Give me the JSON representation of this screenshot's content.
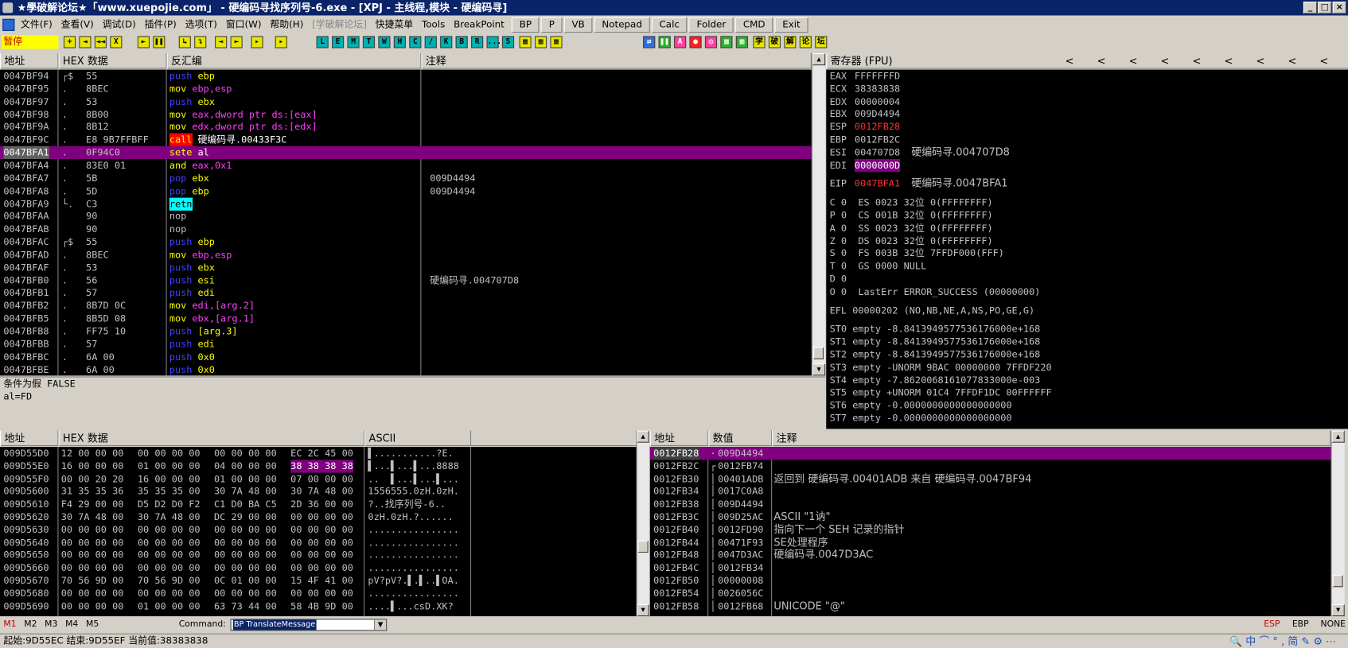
{
  "app": {
    "title": "★學破解论坛★「www.xuepojie.com」 - 硬编码寻找序列号-6.exe - [XPJ - 主线程,模块 - 硬编码寻]"
  },
  "menu": [
    {
      "label": "文件(F)"
    },
    {
      "label": "查看(V)"
    },
    {
      "label": "调试(D)"
    },
    {
      "label": "插件(P)"
    },
    {
      "label": "选项(T)"
    },
    {
      "label": "窗口(W)"
    },
    {
      "label": "帮助(H)"
    },
    {
      "label": "[学破解论坛]",
      "disabled": true
    },
    {
      "label": "快捷菜单"
    },
    {
      "label": "Tools"
    },
    {
      "label": "BreakPoint"
    }
  ],
  "menu_tools": [
    "BP",
    "P",
    "VB",
    "Notepad",
    "Calc",
    "Folder",
    "CMD",
    "Exit"
  ],
  "toolbar": {
    "status": "暂停",
    "letters": [
      "L",
      "E",
      "M",
      "T",
      "W",
      "H",
      "C",
      "/",
      "K",
      "B",
      "R",
      "...",
      "S"
    ],
    "right_chars": [
      "学",
      "破",
      "解",
      "论",
      "坛"
    ]
  },
  "cpu": {
    "headers": {
      "addr": "地址",
      "hex": "HEX 数据",
      "disasm": "反汇编",
      "comment": "注释"
    },
    "rows": [
      {
        "addr": "0047BF94",
        "mark": "┌$",
        "hex": "55",
        "mn": "push",
        "op": "ebp",
        "cmt": ""
      },
      {
        "addr": "0047BF95",
        "mark": ".",
        "hex": "8BEC",
        "mn": "mov",
        "op": "ebp,esp",
        "cmt": ""
      },
      {
        "addr": "0047BF97",
        "mark": ".",
        "hex": "53",
        "mn": "push",
        "op": "ebx",
        "cmt": ""
      },
      {
        "addr": "0047BF98",
        "mark": ".",
        "hex": "8B00",
        "mn": "mov",
        "op": "eax,dword ptr ds:[eax]",
        "cmt": ""
      },
      {
        "addr": "0047BF9A",
        "mark": ".",
        "hex": "8B12",
        "mn": "mov",
        "op": "edx,dword ptr ds:[edx]",
        "cmt": ""
      },
      {
        "addr": "0047BF9C",
        "mark": ".",
        "hex": "E8 9B7FFBFF",
        "mn": "call",
        "op": "硬编码寻.00433F3C",
        "cmt": ""
      },
      {
        "addr": "0047BFA1",
        "mark": ".",
        "hex": "0F94C0",
        "mn": "sete",
        "op": "al",
        "cmt": "",
        "sel": true
      },
      {
        "addr": "0047BFA4",
        "mark": ".",
        "hex": "83E0 01",
        "mn": "and",
        "op": "eax,0x1",
        "cmt": ""
      },
      {
        "addr": "0047BFA7",
        "mark": ".",
        "hex": "5B",
        "mn": "pop",
        "op": "ebx",
        "cmt": "009D4494"
      },
      {
        "addr": "0047BFA8",
        "mark": ".",
        "hex": "5D",
        "mn": "pop",
        "op": "ebp",
        "cmt": "009D4494"
      },
      {
        "addr": "0047BFA9",
        "mark": "└.",
        "hex": "C3",
        "mn": "retn",
        "op": "",
        "cmt": ""
      },
      {
        "addr": "0047BFAA",
        "mark": "",
        "hex": "90",
        "mn": "nop",
        "op": "",
        "cmt": ""
      },
      {
        "addr": "0047BFAB",
        "mark": "",
        "hex": "90",
        "mn": "nop",
        "op": "",
        "cmt": ""
      },
      {
        "addr": "0047BFAC",
        "mark": "┌$",
        "hex": "55",
        "mn": "push",
        "op": "ebp",
        "cmt": ""
      },
      {
        "addr": "0047BFAD",
        "mark": ".",
        "hex": "8BEC",
        "mn": "mov",
        "op": "ebp,esp",
        "cmt": ""
      },
      {
        "addr": "0047BFAF",
        "mark": ".",
        "hex": "53",
        "mn": "push",
        "op": "ebx",
        "cmt": ""
      },
      {
        "addr": "0047BFB0",
        "mark": ".",
        "hex": "56",
        "mn": "push",
        "op": "esi",
        "cmt": "硬编码寻.004707D8"
      },
      {
        "addr": "0047BFB1",
        "mark": ".",
        "hex": "57",
        "mn": "push",
        "op": "edi",
        "cmt": ""
      },
      {
        "addr": "0047BFB2",
        "mark": ".",
        "hex": "8B7D 0C",
        "mn": "mov",
        "op": "edi,[arg.2]",
        "cmt": ""
      },
      {
        "addr": "0047BFB5",
        "mark": ".",
        "hex": "8B5D 08",
        "mn": "mov",
        "op": "ebx,[arg.1]",
        "cmt": ""
      },
      {
        "addr": "0047BFB8",
        "mark": ".",
        "hex": "FF75 10",
        "mn": "push",
        "op": "[arg.3]",
        "cmt": ""
      },
      {
        "addr": "0047BFBB",
        "mark": ".",
        "hex": "57",
        "mn": "push",
        "op": "edi",
        "cmt": ""
      },
      {
        "addr": "0047BFBC",
        "mark": ".",
        "hex": "6A 00",
        "mn": "push",
        "op": "0x0",
        "cmt": ""
      },
      {
        "addr": "0047BFBE",
        "mark": ".",
        "hex": "6A 00",
        "mn": "push",
        "op": "0x0",
        "cmt": ""
      }
    ]
  },
  "info": {
    "line1": "条件为假 FALSE",
    "line2": "al=FD"
  },
  "registers": {
    "header": "寄存器 (FPU)",
    "gp": [
      {
        "name": "EAX",
        "val": "FFFFFFFD",
        "note": ""
      },
      {
        "name": "ECX",
        "val": "38383838",
        "note": ""
      },
      {
        "name": "EDX",
        "val": "00000004",
        "note": ""
      },
      {
        "name": "EBX",
        "val": "009D4494",
        "note": ""
      },
      {
        "name": "ESP",
        "val": "0012FB28",
        "note": "",
        "red": true
      },
      {
        "name": "EBP",
        "val": "0012FB2C",
        "note": ""
      },
      {
        "name": "ESI",
        "val": "004707D8",
        "note": "硬编码寻.004707D8"
      },
      {
        "name": "EDI",
        "val": "0000000D",
        "note": "",
        "hl": true
      }
    ],
    "eip": {
      "name": "EIP",
      "val": "0047BFA1",
      "note": "硬编码寻.0047BFA1"
    },
    "flags": [
      "C 0  ES 0023 32位 0(FFFFFFFF)",
      "P 0  CS 001B 32位 0(FFFFFFFF)",
      "A 0  SS 0023 32位 0(FFFFFFFF)",
      "Z 0  DS 0023 32位 0(FFFFFFFF)",
      "S 0  FS 003B 32位 7FFDF000(FFF)",
      "T 0  GS 0000 NULL",
      "D 0",
      "O 0  LastErr ERROR_SUCCESS (00000000)"
    ],
    "efl": "EFL 00000202 (NO,NB,NE,A,NS,PO,GE,G)",
    "fpu": [
      "ST0 empty -8.8413949577536176000e+168",
      "ST1 empty -8.8413949577536176000e+168",
      "ST2 empty -8.8413949577536176000e+168",
      "ST3 empty -UNORM 9BAC 00000000 7FFDF220",
      "ST4 empty -7.8620068161077833000e-003",
      "ST5 empty +UNORM 01C4 7FFDF1DC 00FFFFFF",
      "ST6 empty -0.0000000000000000000",
      "ST7 empty -0.0000000000000000000"
    ]
  },
  "dump": {
    "headers": {
      "addr": "地址",
      "hex": "HEX 数据",
      "ascii": "ASCII"
    },
    "rows": [
      {
        "addr": "009D55D0",
        "h1": "12 00 00 00",
        "h2": "00 00 00 00",
        "h3": "00 00 00 00",
        "h4": "EC 2C 45 00",
        "ascii": "▌...........?E."
      },
      {
        "addr": "009D55E0",
        "h1": "16 00 00 00",
        "h2": "01 00 00 00",
        "h3": "04 00 00 00",
        "h4": "38 38 38 38",
        "ascii": "▌...▌...▌...8888",
        "hl": true
      },
      {
        "addr": "009D55F0",
        "h1": "00 00 20 20",
        "h2": "16 00 00 00",
        "h3": "01 00 00 00",
        "h4": "07 00 00 00",
        "ascii": "..  ▌...▌...▌..."
      },
      {
        "addr": "009D5600",
        "h1": "31 35 35 36",
        "h2": "35 35 35 00",
        "h3": "30 7A 48 00",
        "h4": "30 7A 48 00",
        "ascii": "1556555.0zH.0zH."
      },
      {
        "addr": "009D5610",
        "h1": "F4 29 00 00",
        "h2": "D5 D2 D0 F2",
        "h3": "C1 D0 BA C5",
        "h4": "2D 36 00 00",
        "ascii": "?..找序列号-6.."
      },
      {
        "addr": "009D5620",
        "h1": "30 7A 48 00",
        "h2": "30 7A 48 00",
        "h3": "DC 29 00 00",
        "h4": "00 00 00 00",
        "ascii": "0zH.0zH.?......"
      },
      {
        "addr": "009D5630",
        "h1": "00 00 00 00",
        "h2": "00 00 00 00",
        "h3": "00 00 00 00",
        "h4": "00 00 00 00",
        "ascii": "................"
      },
      {
        "addr": "009D5640",
        "h1": "00 00 00 00",
        "h2": "00 00 00 00",
        "h3": "00 00 00 00",
        "h4": "00 00 00 00",
        "ascii": "................"
      },
      {
        "addr": "009D5650",
        "h1": "00 00 00 00",
        "h2": "00 00 00 00",
        "h3": "00 00 00 00",
        "h4": "00 00 00 00",
        "ascii": "................"
      },
      {
        "addr": "009D5660",
        "h1": "00 00 00 00",
        "h2": "00 00 00 00",
        "h3": "00 00 00 00",
        "h4": "00 00 00 00",
        "ascii": "................"
      },
      {
        "addr": "009D5670",
        "h1": "70 56 9D 00",
        "h2": "70 56 9D 00",
        "h3": "0C 01 00 00",
        "h4": "15 4F 41 00",
        "ascii": "pV?pV?.▌.▌..▌OA."
      },
      {
        "addr": "009D5680",
        "h1": "00 00 00 00",
        "h2": "00 00 00 00",
        "h3": "00 00 00 00",
        "h4": "00 00 00 00",
        "ascii": "................"
      },
      {
        "addr": "009D5690",
        "h1": "00 00 00 00",
        "h2": "01 00 00 00",
        "h3": "63 73 44 00",
        "h4": "58 4B 9D 00",
        "ascii": "....▌...csD.XK?"
      }
    ]
  },
  "stack": {
    "headers": {
      "addr": "地址",
      "val": "数值",
      "cmt": "注释"
    },
    "rows": [
      {
        "addr": "0012FB28",
        "mark": "·",
        "val": "009D4494",
        "cmt": "",
        "sel": true
      },
      {
        "addr": "0012FB2C",
        "mark": "┌",
        "val": "0012FB74",
        "cmt": ""
      },
      {
        "addr": "0012FB30",
        "mark": "│",
        "val": "00401ADB",
        "cmt": "返回到 硬编码寻.00401ADB 来自 硬编码寻.0047BF94"
      },
      {
        "addr": "0012FB34",
        "mark": "│",
        "val": "0017C0A8",
        "cmt": ""
      },
      {
        "addr": "0012FB38",
        "mark": "│",
        "val": "009D4494",
        "cmt": ""
      },
      {
        "addr": "0012FB3C",
        "mark": "│",
        "val": "009D25AC",
        "cmt": "ASCII \"1讷\""
      },
      {
        "addr": "0012FB40",
        "mark": "│",
        "val": "0012FD90",
        "cmt": "指向下一个 SEH 记录的指针"
      },
      {
        "addr": "0012FB44",
        "mark": "│",
        "val": "00471F93",
        "cmt": "SE处理程序"
      },
      {
        "addr": "0012FB48",
        "mark": "│",
        "val": "0047D3AC",
        "cmt": "硬编码寻.0047D3AC"
      },
      {
        "addr": "0012FB4C",
        "mark": "│",
        "val": "0012FB34",
        "cmt": ""
      },
      {
        "addr": "0012FB50",
        "mark": "│",
        "val": "00000008",
        "cmt": ""
      },
      {
        "addr": "0012FB54",
        "mark": "│",
        "val": "0026056C",
        "cmt": ""
      },
      {
        "addr": "0012FB58",
        "mark": "│",
        "val": "0012FB68",
        "cmt": "UNICODE \"@\""
      }
    ]
  },
  "bottom": {
    "tabs": [
      "M1",
      "M2",
      "M3",
      "M4",
      "M5"
    ],
    "command_label": "Command:",
    "command_value": "BP TranslateMessage",
    "regs": [
      "ESP",
      "EBP",
      "NONE"
    ]
  },
  "status": {
    "text": "起始:9D55EC 结束:9D55EF 当前值:38383838"
  }
}
